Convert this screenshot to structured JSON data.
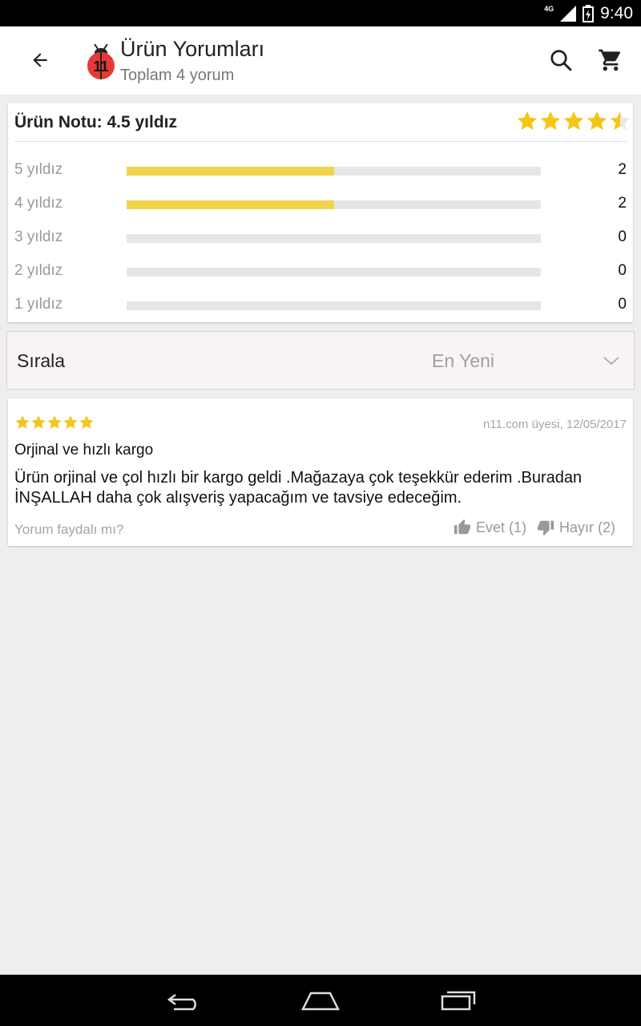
{
  "status_bar": {
    "time": "9:40",
    "network": "4G"
  },
  "app_bar": {
    "title": "Ürün Yorumları",
    "subtitle": "Toplam 4 yorum"
  },
  "rating_summary": {
    "title": "Ürün Notu: 4.5 yıldız",
    "average": 4.5,
    "max": 5,
    "rows": [
      {
        "label": "5 yıldız",
        "count": "2",
        "fraction": 0.5
      },
      {
        "label": "4 yıldız",
        "count": "2",
        "fraction": 0.5
      },
      {
        "label": "3 yıldız",
        "count": "0",
        "fraction": 0
      },
      {
        "label": "2 yıldız",
        "count": "0",
        "fraction": 0
      },
      {
        "label": "1 yıldız",
        "count": "0",
        "fraction": 0
      }
    ]
  },
  "sort": {
    "label": "Sırala",
    "value": "En Yeni"
  },
  "review": {
    "rating": 5,
    "meta": "n11.com üyesi, 12/05/2017",
    "title": "Orjinal ve hızlı kargo",
    "body": "Ürün orjinal ve çol hızlı bir kargo geldi .Mağazaya çok teşekkür ederim .Buradan İNŞALLAH daha çok alışveriş yapacağım ve tavsiye edeceğim.",
    "helpful_question": "Yorum faydalı mı?",
    "yes_label": "Evet (1)",
    "no_label": "Hayır (2)"
  },
  "colors": {
    "star": "#f5c518",
    "bar_fill": "#f0d54a",
    "accent_red": "#e53935"
  }
}
